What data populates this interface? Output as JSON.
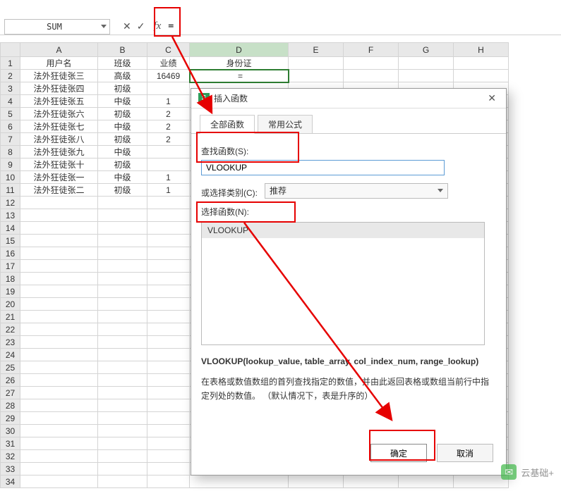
{
  "formula_bar": {
    "namebox": "SUM",
    "formula": "="
  },
  "columns": [
    "A",
    "B",
    "C",
    "D",
    "E",
    "F",
    "G",
    "H"
  ],
  "row_count": 34,
  "headers": {
    "A": "用户名",
    "B": "班级",
    "C": "业绩",
    "D": "身份证"
  },
  "rows": [
    {
      "A": "法外狂徒张三",
      "B": "高级",
      "C": "16469",
      "D": "="
    },
    {
      "A": "法外狂徒张四",
      "B": "初级",
      "C": "",
      "D": ""
    },
    {
      "A": "法外狂徒张五",
      "B": "中级",
      "C": "1",
      "D": ""
    },
    {
      "A": "法外狂徒张六",
      "B": "初级",
      "C": "2",
      "D": ""
    },
    {
      "A": "法外狂徒张七",
      "B": "中级",
      "C": "2",
      "D": ""
    },
    {
      "A": "法外狂徒张八",
      "B": "初级",
      "C": "2",
      "D": ""
    },
    {
      "A": "法外狂徒张九",
      "B": "中级",
      "C": "",
      "D": ""
    },
    {
      "A": "法外狂徒张十",
      "B": "初级",
      "C": "",
      "D": ""
    },
    {
      "A": "法外狂徒张一",
      "B": "中级",
      "C": "1",
      "D": ""
    },
    {
      "A": "法外狂徒张二",
      "B": "初级",
      "C": "1",
      "D": ""
    }
  ],
  "dialog": {
    "title": "插入函数",
    "tab_all": "全部函数",
    "tab_common": "常用公式",
    "search_label": "查找函数(S):",
    "search_value": "VLOOKUP",
    "category_label": "或选择类别(C):",
    "category_value": "推荐",
    "select_label": "选择函数(N):",
    "selected_func": "VLOOKUP",
    "signature": "VLOOKUP(lookup_value, table_array, col_index_num, range_lookup)",
    "description": "在表格或数值数组的首列查找指定的数值，并由此返回表格或数组当前行中指定列处的数值。 （默认情况下，表是升序的）",
    "ok": "确定",
    "cancel": "取消"
  },
  "watermark": "云基础+"
}
